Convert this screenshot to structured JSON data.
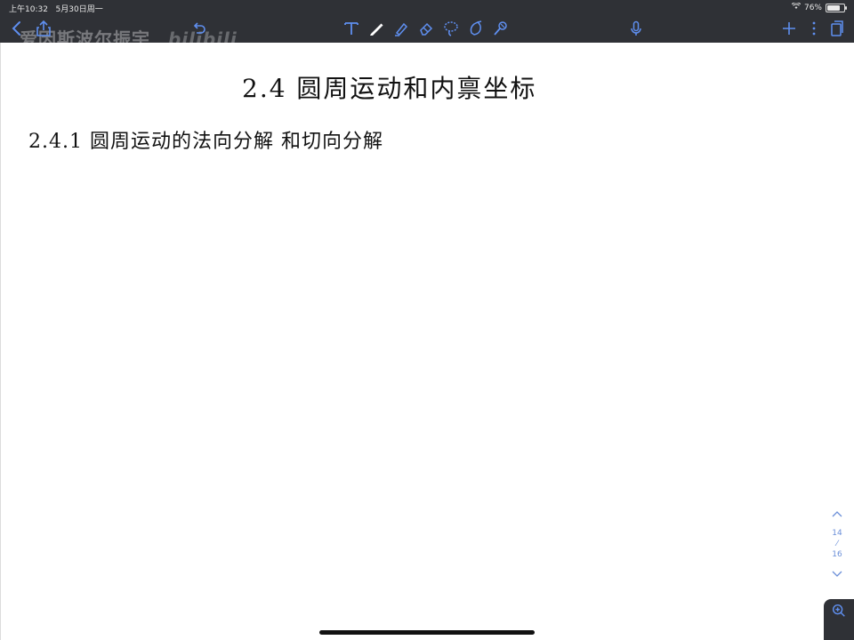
{
  "status_bar": {
    "time": "上午10:32",
    "date": "5月30日周一",
    "battery_percent": 76,
    "battery_text": "76%"
  },
  "watermark": {
    "left_text": "爱因斯波尔振宇",
    "brand_text": "bilibili"
  },
  "toolbar": {
    "left_icons": [
      "chevron-left-icon",
      "share-icon",
      "undo-icon"
    ],
    "center_tools": [
      "text-tool",
      "pen-tool",
      "highlighter-tool",
      "eraser-tool",
      "lasso-tool",
      "shape-tool",
      "image-tool"
    ],
    "mic_icon": "microphone-icon",
    "right_icons": [
      "plus-icon",
      "more-icon",
      "pages-icon"
    ]
  },
  "document": {
    "title": "2.4  圆周运动和内禀坐标",
    "section_heading": "2.4.1  圆周运动的法向分解 和切向分解"
  },
  "pager": {
    "current": "14",
    "total": "16",
    "separator": "⁄"
  },
  "colors": {
    "toolbar_bg": "#2f3136",
    "accent": "#6b8fd8",
    "tool_icon": "#5f8ff0"
  }
}
